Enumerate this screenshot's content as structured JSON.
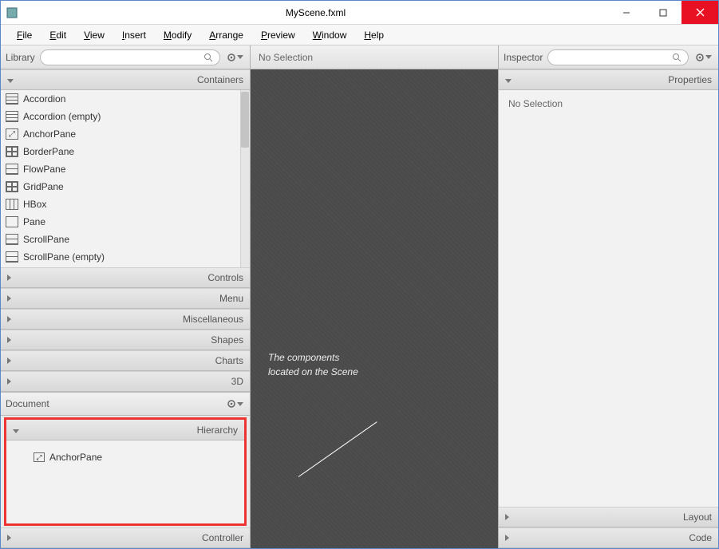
{
  "window": {
    "title": "MyScene.fxml"
  },
  "menubar": [
    {
      "ul": "F",
      "rest": "ile"
    },
    {
      "ul": "E",
      "rest": "dit"
    },
    {
      "ul": "V",
      "rest": "iew"
    },
    {
      "ul": "I",
      "rest": "nsert"
    },
    {
      "ul": "M",
      "rest": "odify"
    },
    {
      "ul": "A",
      "rest": "rrange"
    },
    {
      "ul": "P",
      "rest": "review"
    },
    {
      "ul": "W",
      "rest": "indow"
    },
    {
      "ul": "H",
      "rest": "elp"
    }
  ],
  "library": {
    "title": "Library",
    "sections": {
      "containers": "Containers",
      "controls": "Controls",
      "menu": "Menu",
      "misc": "Miscellaneous",
      "shapes": "Shapes",
      "charts": "Charts",
      "three_d": "3D"
    },
    "containers_items": [
      "Accordion",
      "Accordion  (empty)",
      "AnchorPane",
      "BorderPane",
      "FlowPane",
      "GridPane",
      "HBox",
      "Pane",
      "ScrollPane",
      "ScrollPane  (empty)"
    ]
  },
  "document": {
    "title": "Document",
    "hierarchy_label": "Hierarchy",
    "controller_label": "Controller",
    "root_item": "AnchorPane"
  },
  "center": {
    "status": "No Selection",
    "annotation_line1": "The components",
    "annotation_line2": "located on the Scene"
  },
  "inspector": {
    "title": "Inspector",
    "properties_label": "Properties",
    "layout_label": "Layout",
    "code_label": "Code",
    "body_text": "No Selection"
  }
}
